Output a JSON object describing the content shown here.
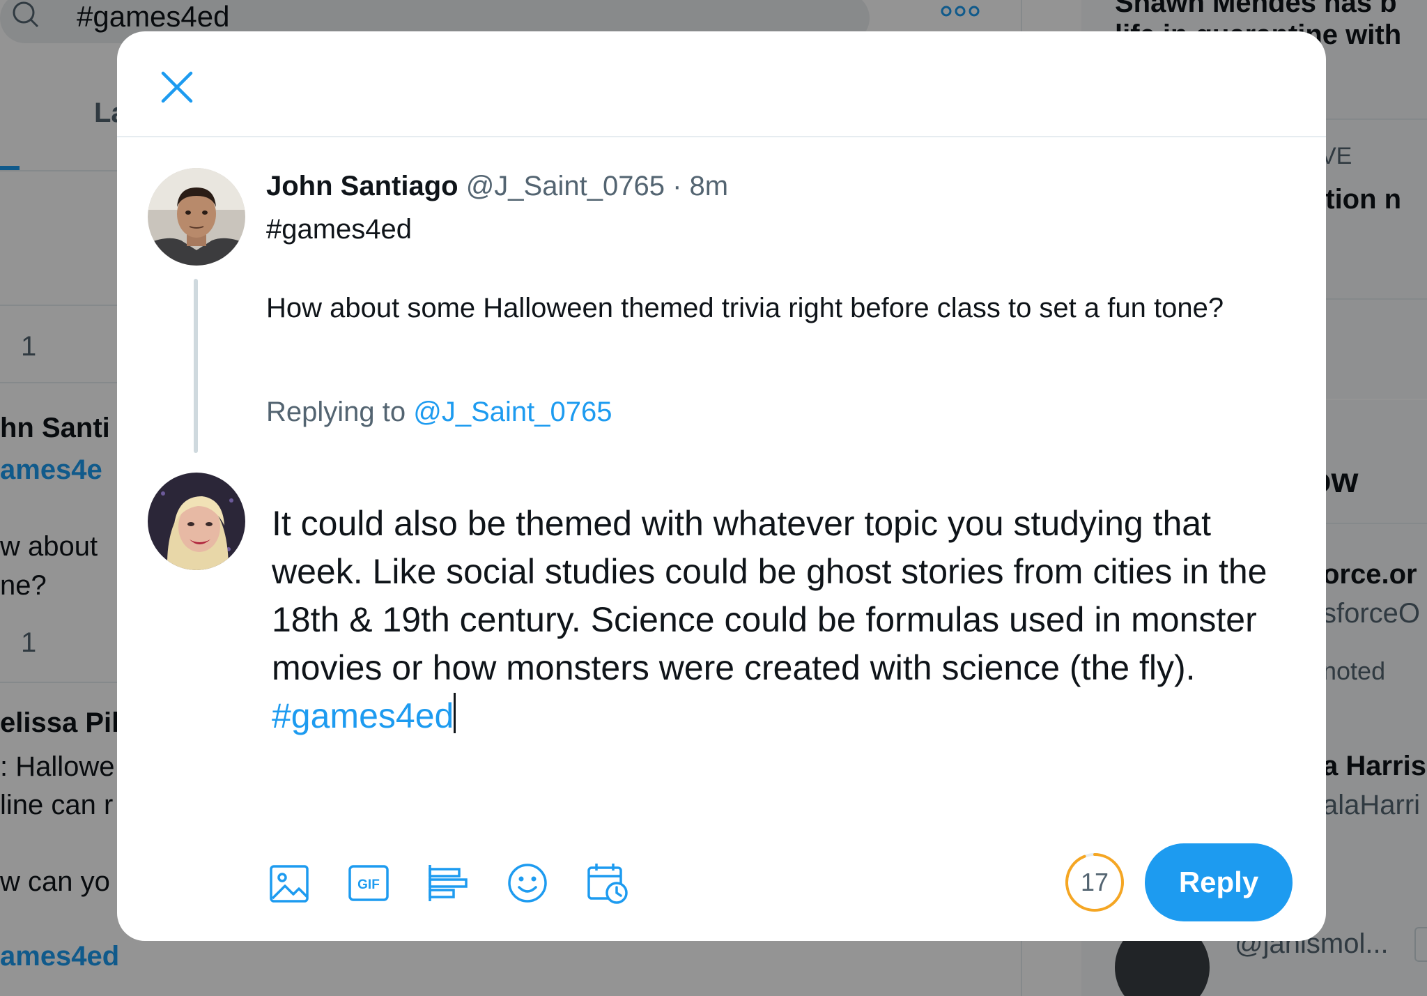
{
  "background": {
    "search_query": "#games4ed",
    "tab_latest": "La",
    "right_header_line1": "Shawn Mendes has b",
    "right_header_line2": "life in quarantine with",
    "right_live": "VE",
    "right_action": "ction n",
    "right_follow": "ow",
    "right_force": "orce.or",
    "right_force_handle": "sforceO",
    "right_promoted": "noted",
    "right_harris": "a Harris",
    "right_harris_handle": "alaHarri",
    "right_bottom_handle": "@janismol...",
    "left_count_1": "1",
    "left_name_1": "hn Santi",
    "left_hashtag_1": "ames4e",
    "left_text_1a": "w about",
    "left_text_1b": "ne?",
    "left_count_2": "1",
    "left_name_2": "elissa Pil",
    "left_text_2a": ": Hallowe",
    "left_text_2b": "line can r",
    "left_text_2c": "w can yo",
    "left_hashtag_2": "ames4ed"
  },
  "modal": {
    "original_tweet": {
      "name": "John Santiago",
      "handle": "@J_Saint_0765",
      "separator": "·",
      "time": "8m",
      "hashtag": "#games4ed",
      "body": "How about some Halloween themed trivia right before class to set a fun tone?"
    },
    "replying_to_label": "Replying to",
    "replying_to_handle": "@J_Saint_0765",
    "compose_text": "It could also be themed with whatever topic you studying that week. Like social studies could be ghost stories from cities in the 18th & 19th century. Science could be formulas used in monster movies or how monsters were created with science (the fly).  ",
    "compose_hashtag": "#games4ed",
    "toolbar": {
      "gif_label": "GIF"
    },
    "chars_remaining": "17",
    "chars_used_fraction": 0.94,
    "reply_label": "Reply",
    "colors": {
      "accent": "#1d9bf0",
      "counter_warning": "#f5a623"
    }
  }
}
